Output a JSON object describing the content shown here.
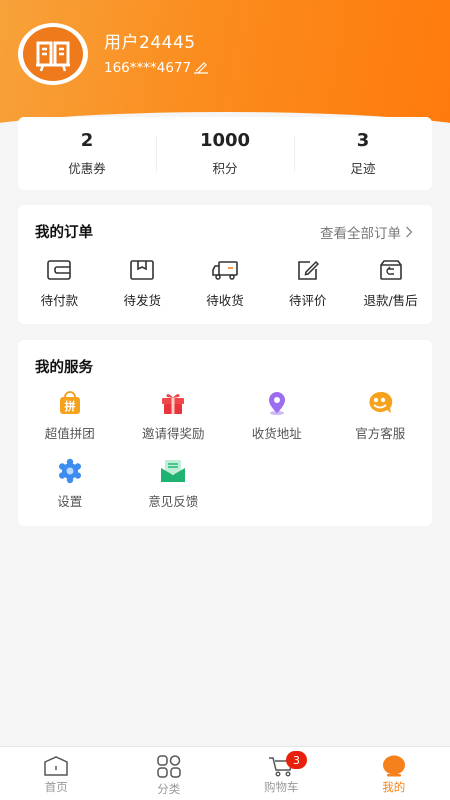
{
  "profile": {
    "username": "用户24445",
    "phone": "166****4677",
    "avatar_icon": "shop-logo-icon"
  },
  "stats": [
    {
      "value": "2",
      "label": "优惠券"
    },
    {
      "value": "1000",
      "label": "积分"
    },
    {
      "value": "3",
      "label": "足迹"
    }
  ],
  "orders": {
    "title": "我的订单",
    "view_all": "查看全部订单",
    "items": [
      {
        "label": "待付款",
        "icon": "wallet-icon"
      },
      {
        "label": "待发货",
        "icon": "package-icon"
      },
      {
        "label": "待收货",
        "icon": "truck-icon"
      },
      {
        "label": "待评价",
        "icon": "edit-review-icon"
      },
      {
        "label": "退款/售后",
        "icon": "refund-icon"
      }
    ]
  },
  "services": {
    "title": "我的服务",
    "items": [
      {
        "label": "超值拼团",
        "icon": "group-buy-icon",
        "icon_text": "拼"
      },
      {
        "label": "邀请得奖励",
        "icon": "gift-icon"
      },
      {
        "label": "收货地址",
        "icon": "location-pin-icon"
      },
      {
        "label": "官方客服",
        "icon": "customer-service-icon"
      },
      {
        "label": "设置",
        "icon": "gear-icon"
      },
      {
        "label": "意见反馈",
        "icon": "feedback-mail-icon"
      }
    ]
  },
  "tabbar": {
    "items": [
      {
        "label": "首页",
        "icon": "home-icon"
      },
      {
        "label": "分类",
        "icon": "category-grid-icon"
      },
      {
        "label": "购物车",
        "icon": "cart-icon",
        "badge": "3"
      },
      {
        "label": "我的",
        "icon": "user-icon"
      }
    ],
    "active_index": 3
  },
  "colors": {
    "accent": "#f6811c",
    "badge": "#e8210e"
  }
}
